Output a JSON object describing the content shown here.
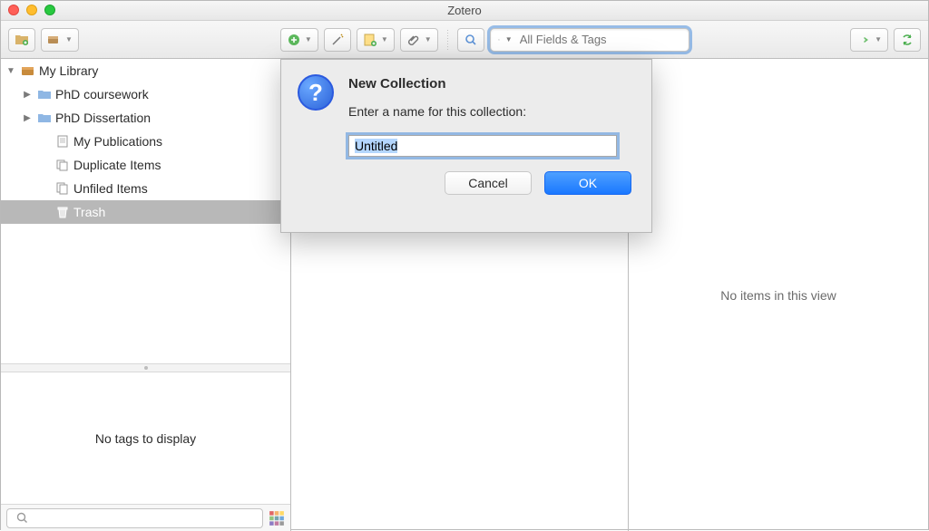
{
  "window": {
    "title": "Zotero"
  },
  "toolbar": {
    "search_placeholder": "All Fields & Tags"
  },
  "sidebar": {
    "items": [
      {
        "label": "My Library",
        "icon": "library",
        "expandable": true,
        "expanded": true,
        "level": 0
      },
      {
        "label": "PhD coursework",
        "icon": "folder",
        "expandable": true,
        "expanded": false,
        "level": 1
      },
      {
        "label": "PhD Dissertation",
        "icon": "folder",
        "expandable": true,
        "expanded": false,
        "level": 1
      },
      {
        "label": "My Publications",
        "icon": "doc",
        "expandable": false,
        "level": 2
      },
      {
        "label": "Duplicate Items",
        "icon": "duplicate",
        "expandable": false,
        "level": 2
      },
      {
        "label": "Unfiled Items",
        "icon": "unfiled",
        "expandable": false,
        "level": 2
      },
      {
        "label": "Trash",
        "icon": "trash",
        "expandable": false,
        "selected": true,
        "level": 2
      }
    ],
    "tags_empty": "No tags to display"
  },
  "itempane": {
    "empty": "No items in this view"
  },
  "dialog": {
    "title": "New Collection",
    "message": "Enter a name for this collection:",
    "input_value": "Untitled",
    "cancel": "Cancel",
    "ok": "OK"
  }
}
